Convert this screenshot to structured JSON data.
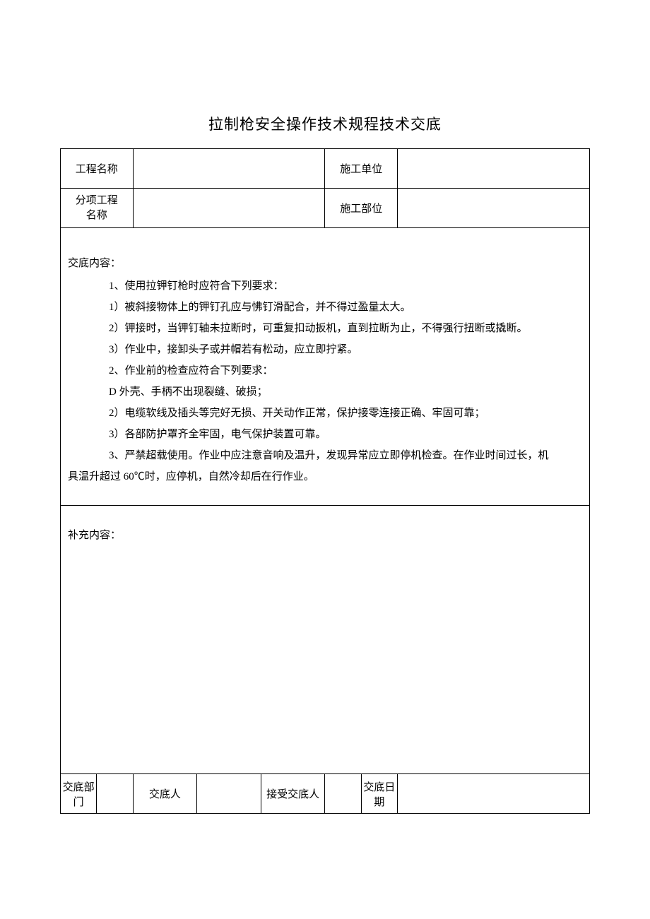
{
  "title": "拉制枪安全操作技术规程技术交底",
  "header": {
    "project_name_label": "工程名称",
    "project_name_value": "",
    "construction_unit_label": "施工单位",
    "construction_unit_value": "",
    "subproject_label_line1": "分项工程",
    "subproject_label_line2": "名称",
    "subproject_value": "",
    "construction_part_label": "施工部位",
    "construction_part_value": ""
  },
  "content": {
    "heading": "交底内容：",
    "items": [
      "1、使用拉钾钉枪时应符合下列要求：",
      "1）被斜接物体上的钾钉孔应与怫钉滑配合，并不得过盈量太大。",
      "2）钾接时，当钾钉轴未拉断时，可重复扣动扳机，直到拉断为止，不得强行扭断或撬断。",
      "3）作业中，接卸头子或并帽若有松动，应立即拧紧。",
      "2、作业前的检查应符合下列要求：",
      "D 外壳、手柄不出现裂缝、破损；",
      "2）电缆软线及插头等完好无损、开关动作正常，保护接零连接正确、牢固可靠；",
      "3）各部防护罩齐全牢固，电气保护装置可靠。"
    ],
    "last_item_part1": "3、严禁超载使用。作业中应注意音响及温升，发现异常应立即停机检查。在作业时间过长，机",
    "last_item_part2": "具温升超过 60℃时，应停机，自然冷却后在行作业。"
  },
  "supplementary": {
    "heading": "补充内容："
  },
  "footer": {
    "dept_label": "交底部门",
    "dept_value": "",
    "person_label": "交底人",
    "person_value": "",
    "receiver_label": "接受交底人",
    "receiver_value": "",
    "date_label": "交底日期",
    "date_value": ""
  }
}
